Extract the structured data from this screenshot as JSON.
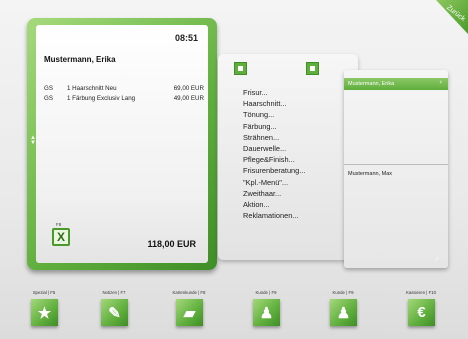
{
  "back_label": "Zurück",
  "receipt": {
    "time": "08:51",
    "customer": "Mustermann, Erika",
    "lines": [
      {
        "code": "GS",
        "desc": "1 Haarschnitt Neu",
        "price": "69,00 EUR"
      },
      {
        "code": "GS",
        "desc": "1 Färbung Exclusiv Lang",
        "price": "49,00 EUR"
      }
    ],
    "total": "118,00 EUR",
    "cancel_hint": "F8",
    "cancel_symbol": "X"
  },
  "menu": {
    "items": [
      "Frisur...",
      "Haarschnitt...",
      "Tönung...",
      "Färbung...",
      "Strähnen...",
      "Dauerwelle...",
      "Pflege&Finish...",
      "Frisurenberatung...",
      "\"Kpl.-Menü\"...",
      "Zweithaar...",
      "Aktion...",
      "Reklamationen..."
    ]
  },
  "customers": {
    "selected": "Mustermann, Erika",
    "other": "Mustermann, Max"
  },
  "function_buttons": [
    {
      "label": "Spezial | F5",
      "icon": "star-icon",
      "glyph": "★"
    },
    {
      "label": "Notizen | F7",
      "icon": "notes-icon",
      "glyph": "✎"
    },
    {
      "label": "Kartenkunde | F8",
      "icon": "folder-icon",
      "glyph": "▰"
    },
    {
      "label": "Kunde | F9",
      "icon": "person-icon",
      "glyph": "♟"
    },
    {
      "label": "Kunde | F9",
      "icon": "person-card-icon",
      "glyph": "♟"
    },
    {
      "label": "Kassieren | F10",
      "icon": "euro-icon",
      "glyph": "€"
    }
  ],
  "colors": {
    "accent": "#5fae3d",
    "accent_dark": "#3f8e26",
    "accent_light": "#a6da7c"
  }
}
